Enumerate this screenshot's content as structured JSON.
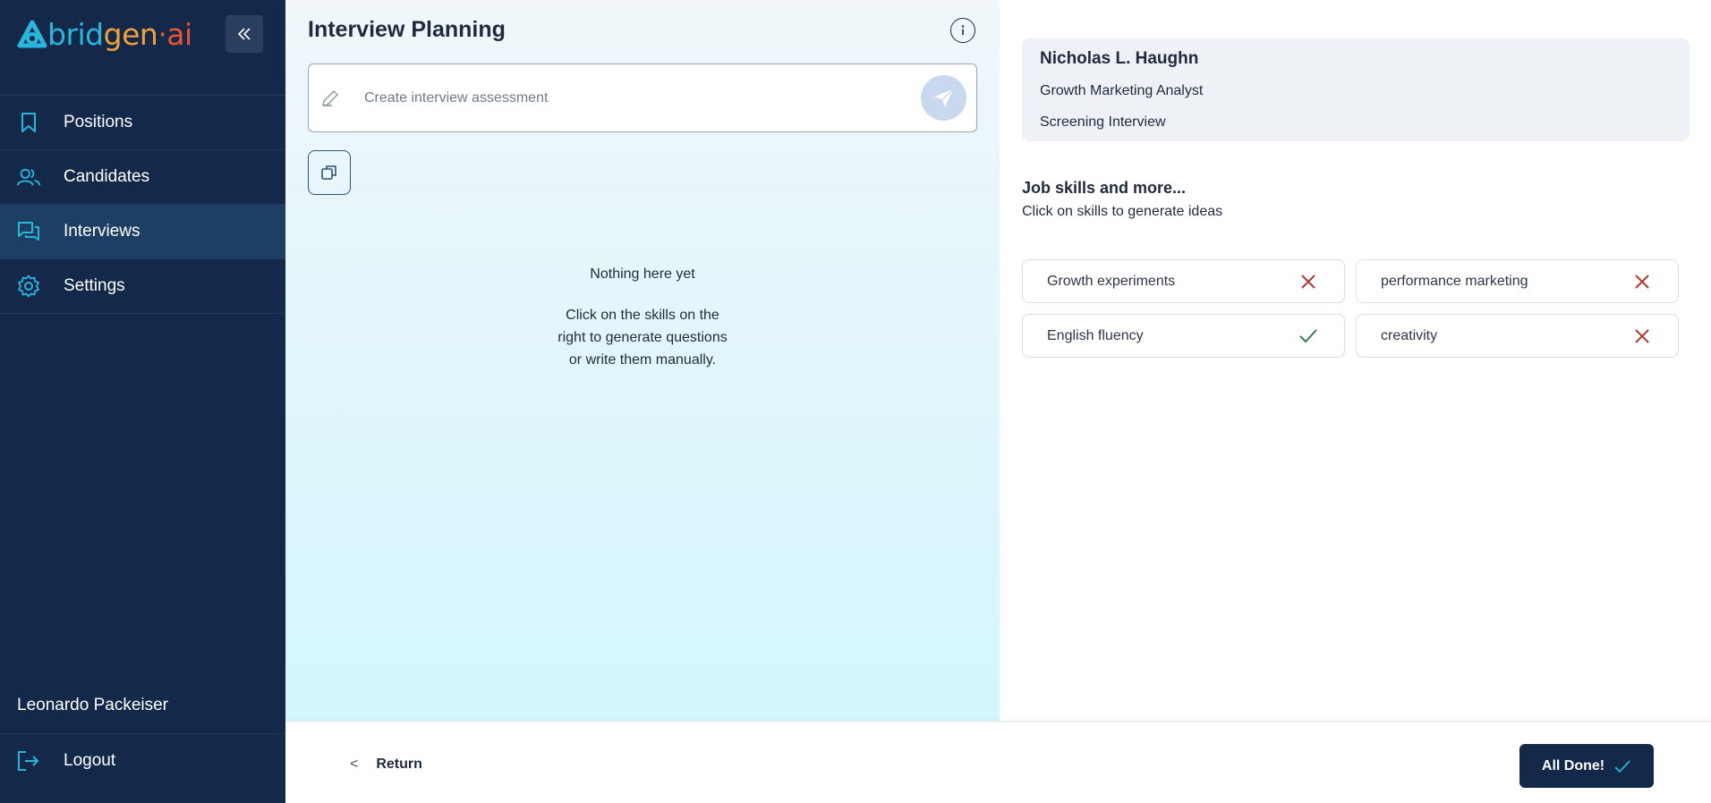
{
  "brand": {
    "part1": "bridgen",
    "part2": "gen",
    "dot": "·",
    "part3": "ai"
  },
  "sidebar": {
    "items": [
      {
        "label": "Positions",
        "icon": "bookmark-icon"
      },
      {
        "label": "Candidates",
        "icon": "users-icon"
      },
      {
        "label": "Interviews",
        "icon": "chat-icon",
        "active": true
      },
      {
        "label": "Settings",
        "icon": "gear-icon"
      }
    ],
    "user_name": "Leonardo Packeiser",
    "logout_label": "Logout"
  },
  "planning": {
    "title": "Interview Planning",
    "input_placeholder": "Create interview assessment",
    "input_value": "",
    "empty_title": "Nothing here yet",
    "empty_text": "Click on the skills on the right to generate questions or write them manually."
  },
  "candidate": {
    "name": "Nicholas L. Haughn",
    "role": "Growth Marketing Analyst",
    "interview_type": "Screening Interview"
  },
  "skills": {
    "title": "Job skills and more...",
    "subtitle": "Click on skills to generate ideas",
    "items": [
      {
        "label": "Growth experiments",
        "status": "remove"
      },
      {
        "label": "performance marketing",
        "status": "remove"
      },
      {
        "label": "English fluency",
        "status": "selected"
      },
      {
        "label": "creativity",
        "status": "remove"
      }
    ]
  },
  "footer": {
    "return_chevron": "<",
    "return_label": "Return",
    "done_label": "All Done!"
  },
  "colors": {
    "sidebar_bg": "#14294a",
    "accent": "#29b6dd",
    "remove": "#b23a2f",
    "selected": "#2e7d52"
  }
}
